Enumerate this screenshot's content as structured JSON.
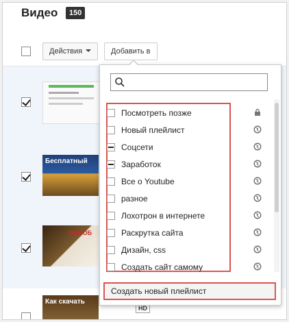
{
  "header": {
    "title": "Видео",
    "count": "150"
  },
  "toolbar": {
    "actions_label": "Действия",
    "add_to_label": "Добавить в"
  },
  "videos": [
    {
      "selected": true,
      "thumb_text": ""
    },
    {
      "selected": true,
      "thumb_text": "Бесплатный"
    },
    {
      "selected": true,
      "thumb_text": "ИНФОБ"
    },
    {
      "selected": false,
      "thumb_text": "Как скачать"
    }
  ],
  "hd_badge": "HD",
  "dropdown": {
    "search_placeholder": "",
    "playlists": [
      {
        "label": "Посмотреть позже",
        "state": "unchecked",
        "icon": "lock-icon"
      },
      {
        "label": "Новый плейлист",
        "state": "unchecked",
        "icon": "globe-icon"
      },
      {
        "label": "Соцсети",
        "state": "partial",
        "icon": "globe-icon"
      },
      {
        "label": "Заработок",
        "state": "partial",
        "icon": "globe-icon"
      },
      {
        "label": "Все о Youtube",
        "state": "unchecked",
        "icon": "globe-icon"
      },
      {
        "label": "разное",
        "state": "unchecked",
        "icon": "globe-icon"
      },
      {
        "label": "Лохотрон в интернете",
        "state": "unchecked",
        "icon": "globe-icon"
      },
      {
        "label": "Раскрутка сайта",
        "state": "unchecked",
        "icon": "globe-icon"
      },
      {
        "label": "Дизайн, css",
        "state": "unchecked",
        "icon": "globe-icon"
      },
      {
        "label": "Создать сайт самому",
        "state": "unchecked",
        "icon": "globe-icon"
      }
    ],
    "create_label": "Создать новый плейлист"
  },
  "colors": {
    "highlight_border": "#d9534f",
    "selected_row": "#f0f5fb",
    "count_badge": "#333333"
  }
}
